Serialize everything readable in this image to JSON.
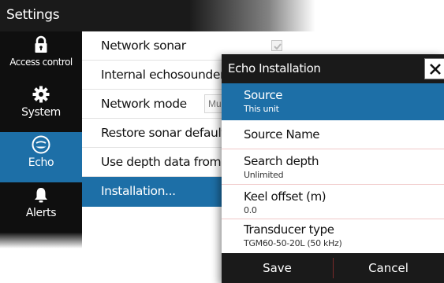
{
  "header": {
    "title": "Settings"
  },
  "sidebar": {
    "items": [
      {
        "label": "Access control",
        "icon": "lock-icon"
      },
      {
        "label": "System",
        "icon": "gear-icon"
      },
      {
        "label": "Echo",
        "icon": "echo-icon",
        "active": true
      },
      {
        "label": "Alerts",
        "icon": "bell-icon"
      }
    ]
  },
  "settings": {
    "rows": [
      {
        "label": "Network sonar",
        "checked": true
      },
      {
        "label": "Internal echosounder"
      },
      {
        "label": "Network mode",
        "value": "Mu"
      },
      {
        "label": "Restore sonar defaults..."
      },
      {
        "label": "Use depth data from"
      },
      {
        "label": "Installation...",
        "active": true
      }
    ]
  },
  "dialog": {
    "title": "Echo Installation",
    "close_icon": "close-icon",
    "items": [
      {
        "label": "Source",
        "value": "This unit",
        "active": true
      },
      {
        "label": "Source Name"
      },
      {
        "label": "Search depth",
        "value": "Unlimited"
      },
      {
        "label": "Keel offset (m)",
        "value": "0.0"
      },
      {
        "label": "Transducer type",
        "value": "TGM60-50-20L (50 kHz)"
      }
    ],
    "buttons": {
      "save": "Save",
      "cancel": "Cancel"
    }
  },
  "colors": {
    "accent": "#1d6fa7",
    "bar": "#1a1a1a",
    "sidebar": "#0f0f0f",
    "divider": "#f0c8c8"
  }
}
